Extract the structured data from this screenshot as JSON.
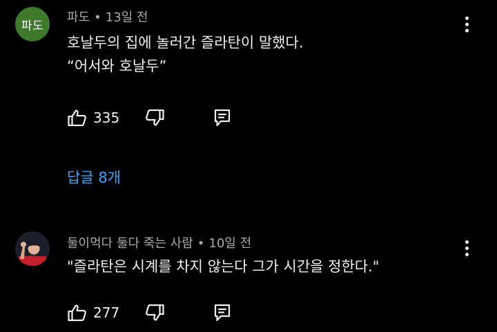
{
  "comments": [
    {
      "avatar_initials": "파도",
      "avatar_color": "#3f7a2c",
      "author": "파도",
      "time": "13일 전",
      "body_lines": [
        "호날두의 집에 놀러간 즐라탄이 말했다.",
        "“어서와 호날두”"
      ],
      "like_count": "335",
      "replies_label": "답글 8개",
      "icons": [
        "thumbs-up-icon",
        "thumbs-down-icon",
        "reply-icon",
        "more-vert-icon"
      ]
    },
    {
      "avatar_initials": "",
      "avatar_color": "#1c1f2a",
      "author": "둘이먹다 둘다 죽는 사람",
      "time": "10일 전",
      "body_lines": [
        "\"즐라탄은 시계를 차지 않는다 그가 시간을 정한다.\""
      ],
      "like_count": "277",
      "icons": [
        "thumbs-up-icon",
        "thumbs-down-icon",
        "reply-icon",
        "more-vert-icon"
      ]
    }
  ],
  "meta_separator": "•",
  "colors": {
    "background": "#000000",
    "primary_text": "#f1f1f1",
    "secondary_text": "#aaaaaa",
    "link": "#3ea6ff"
  }
}
